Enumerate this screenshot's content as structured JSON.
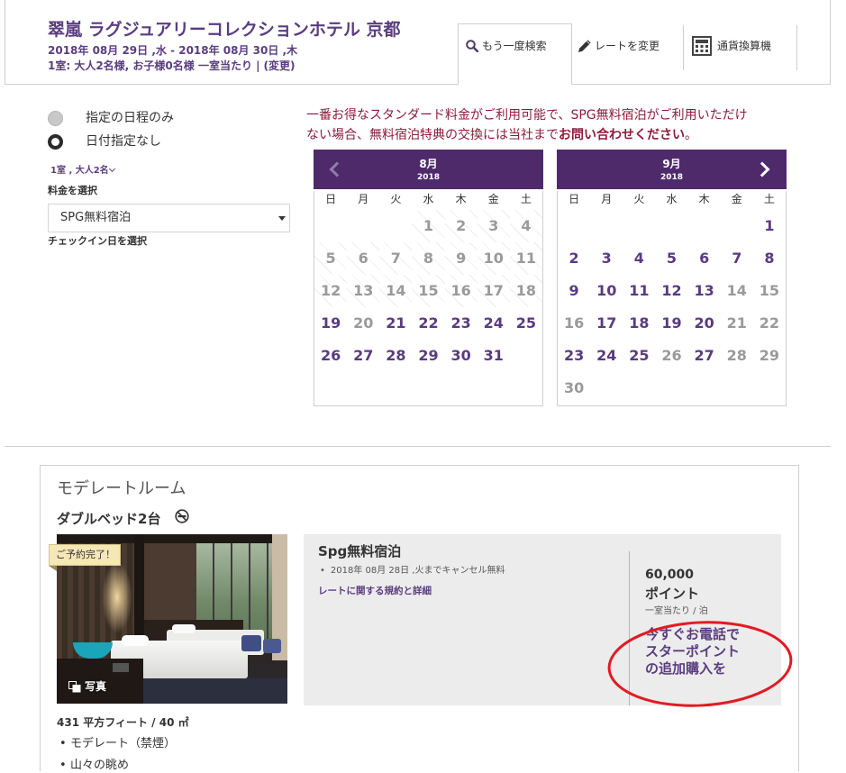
{
  "colors": {
    "brand_purple": "#5a3d80",
    "calendar_header": "#4f2a6b",
    "available_date": "#5b3a80",
    "unavailable_date": "#9a9a9a",
    "notice_red": "#8c1c3c",
    "annotation_red": "#e21b23",
    "rate_box_bg": "#ececec",
    "badge_bg": "#f6e7b7"
  },
  "hotel": {
    "name": "翠嵐 ラグジュアリーコレクションホテル 京都",
    "dates": "2018年 08月 29日 ,水 - 2018年 08月 30日 ,木",
    "occupancy": "1室: 大人2名様, お子様0名様 一室当たり |",
    "change_link": "(変更)"
  },
  "tabs": [
    {
      "label": "もう一度検索",
      "icon": "search-icon",
      "active": true
    },
    {
      "label": "レートを変更",
      "icon": "pencil-icon",
      "active": false
    },
    {
      "label": "通貨換算機",
      "icon": "calculator-icon",
      "active": false
    }
  ],
  "search": {
    "date_options": [
      {
        "label": "指定の日程のみ",
        "selected": false
      },
      {
        "label": "日付指定なし",
        "selected": true
      }
    ],
    "rooms_guests": "1室 , 大人2名",
    "rooms_guests_icon": "chevron-down-icon",
    "rate_label": "料金を選択",
    "rate_selected": "SPG無料宿泊",
    "checkin_label": "チェックイン日を選択"
  },
  "notice": {
    "line1": "一番お得なスタンダード料金がご利用可能で、SPG無料宿泊がご利用いただけ",
    "line2": "ない場合、無料宿泊特典の交換には当社まで",
    "line2_bold": "お問い合わせください",
    "line2_end": "。"
  },
  "calendar_weekdays": [
    "日",
    "月",
    "火",
    "水",
    "木",
    "金",
    "土"
  ],
  "calendars": [
    {
      "month": "8月",
      "year": "2018",
      "nav_icon": "chevron-left-icon",
      "weeks": [
        [
          null,
          null,
          null,
          1,
          2,
          3,
          4
        ],
        [
          5,
          6,
          7,
          8,
          9,
          10,
          11
        ],
        [
          12,
          13,
          14,
          15,
          16,
          17,
          18
        ],
        [
          19,
          20,
          21,
          22,
          23,
          24,
          25
        ],
        [
          26,
          27,
          28,
          29,
          30,
          31,
          null
        ]
      ],
      "available_days": [
        19,
        21,
        22,
        23,
        24,
        25,
        26,
        27,
        28,
        29,
        30,
        31
      ],
      "past_days": [
        1,
        2,
        3,
        4,
        5,
        6,
        7,
        8,
        9,
        10,
        11,
        12,
        13,
        14,
        15,
        16,
        17,
        18
      ]
    },
    {
      "month": "9月",
      "year": "2018",
      "nav_icon": "chevron-right-icon",
      "weeks": [
        [
          null,
          null,
          null,
          null,
          null,
          null,
          1
        ],
        [
          2,
          3,
          4,
          5,
          6,
          7,
          8
        ],
        [
          9,
          10,
          11,
          12,
          13,
          14,
          15
        ],
        [
          16,
          17,
          18,
          19,
          20,
          21,
          22
        ],
        [
          23,
          24,
          25,
          26,
          27,
          28,
          29
        ],
        [
          30,
          null,
          null,
          null,
          null,
          null,
          null
        ]
      ],
      "available_days": [
        1,
        2,
        3,
        4,
        5,
        6,
        7,
        8,
        9,
        10,
        11,
        12,
        13,
        17,
        18,
        19,
        20,
        23,
        24,
        25,
        27
      ],
      "past_days": []
    }
  ],
  "room": {
    "name": "モデレートルーム",
    "bed": "ダブルベッド2台",
    "bed_icon": "no-smoking-icon",
    "badge": "ご予約完了！",
    "photo_label": "写真",
    "photo_icon": "photo-icon",
    "size": "431 平方フィート / 40 ㎡",
    "features": [
      "モデレート（禁煙）",
      "山々の眺め"
    ],
    "rate": {
      "name": "Spg無料宿泊",
      "policies": [
        "2018年 08月 28日 ,火までキャンセル無料"
      ],
      "details_link": "レートに関する規約と詳細",
      "points": "60,000",
      "points_unit": "ポイント",
      "per_night": "一室当たり / 泊",
      "buy_points_lines": [
        "今すぐお電話で",
        "スターポイント",
        "の追加購入を"
      ]
    }
  }
}
